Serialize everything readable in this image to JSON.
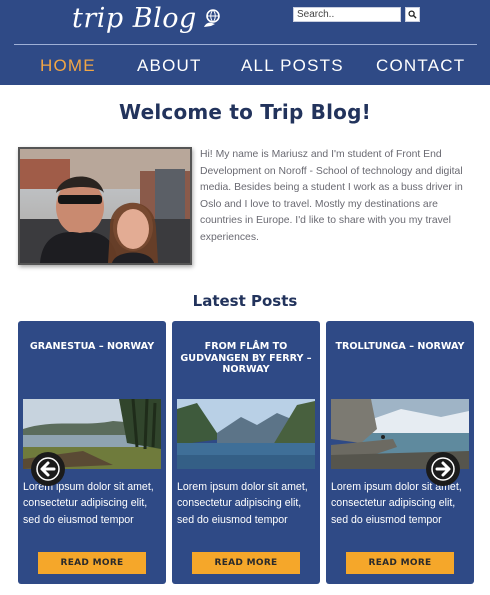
{
  "header": {
    "logo_text": "trip Blog",
    "logo_icon": "globe-hand-icon",
    "search": {
      "placeholder": "Search..",
      "button_icon": "search-icon"
    },
    "nav": [
      {
        "label": "HOME",
        "active": true
      },
      {
        "label": "ABOUT",
        "active": false
      },
      {
        "label": "ALL POSTS",
        "active": false
      },
      {
        "label": "CONTACT",
        "active": false
      }
    ]
  },
  "main": {
    "title": "Welcome to Trip Blog!",
    "about_text": "Hi! My name is Mariusz and I'm student of Front End Development on Noroff - School of technology and digital media. Besides being a student I work as a buss driver in Oslo and I love to travel. Mostly my destinations are countries in Europe. I'd like to share with you my travel experiences.",
    "latest_posts_title": "Latest Posts",
    "posts": [
      {
        "title": "GRANESTUA – NORWAY",
        "excerpt": "Lorem ipsum dolor sit amet, consectetur adipiscing elit, sed do eiusmod tempor",
        "button": "READ MORE"
      },
      {
        "title": "FROM FLÅM TO GUDVANGEN BY FERRY – NORWAY",
        "excerpt": "Lorem ipsum dolor sit amet, consectetur adipiscing elit, sed do eiusmod tempor",
        "button": "READ MORE"
      },
      {
        "title": "TROLLTUNGA – NORWAY",
        "excerpt": "Lorem ipsum dolor sit amet, consectetur adipiscing elit, sed do eiusmod tempor",
        "button": "READ MORE"
      }
    ],
    "carousel": {
      "prev_icon": "arrow-left-icon",
      "next_icon": "arrow-right-icon"
    }
  },
  "colors": {
    "header_bg": "#2f4a86",
    "nav_active": "#f2a645",
    "card_bg": "#2f4a86",
    "button_bg": "#f5a72a",
    "title_text": "#22335c"
  }
}
